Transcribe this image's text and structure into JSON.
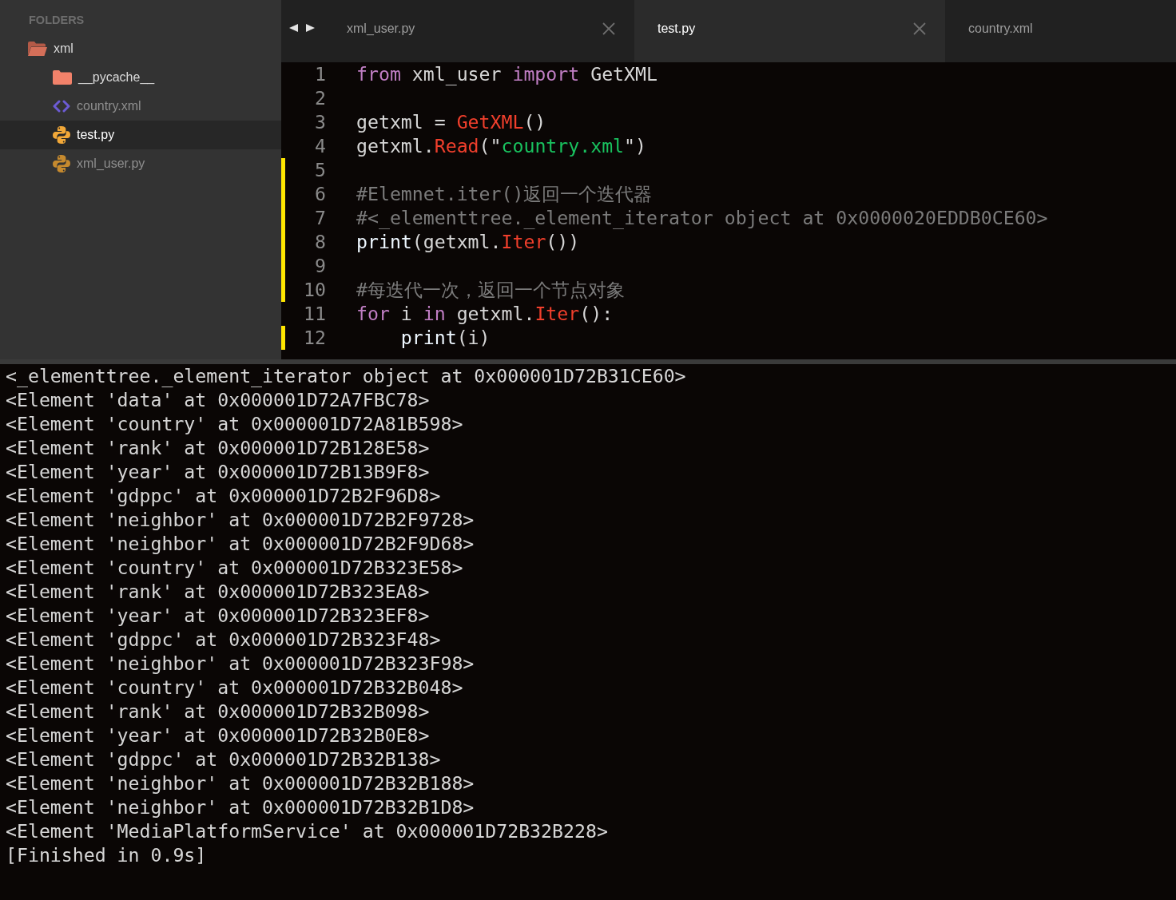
{
  "sidebar": {
    "heading": "FOLDERS",
    "tree": [
      {
        "label": "xml",
        "kind": "folder",
        "expanded": true,
        "selected": false,
        "children": [
          {
            "label": "__pycache__",
            "kind": "folder",
            "expanded": false,
            "selected": false
          },
          {
            "label": "country.xml",
            "kind": "xml",
            "selected": false
          },
          {
            "label": "test.py",
            "kind": "python",
            "selected": true
          },
          {
            "label": "xml_user.py",
            "kind": "python",
            "selected": false
          }
        ]
      }
    ]
  },
  "tabs": [
    {
      "label": "xml_user.py",
      "selected": false,
      "closable": true
    },
    {
      "label": "test.py",
      "selected": true,
      "closable": true
    },
    {
      "label": "country.xml",
      "selected": false,
      "closable": false
    }
  ],
  "editor": {
    "lines": [
      {
        "number": "1",
        "modified": false,
        "tokens": [
          {
            "text": "from",
            "kind": "keyword"
          },
          {
            "text": " xml_user ",
            "kind": "plain"
          },
          {
            "text": "import",
            "kind": "keyword"
          },
          {
            "text": " GetXML",
            "kind": "plain"
          }
        ]
      },
      {
        "number": "2",
        "modified": false
      },
      {
        "number": "3",
        "modified": false,
        "tokens": [
          {
            "text": "getxml = ",
            "kind": "plain"
          },
          {
            "text": "GetXML",
            "kind": "call"
          },
          {
            "text": "()",
            "kind": "plain"
          }
        ]
      },
      {
        "number": "4",
        "modified": false,
        "tokens": [
          {
            "text": "getxml.",
            "kind": "plain"
          },
          {
            "text": "Read",
            "kind": "call"
          },
          {
            "text": "(\"",
            "kind": "plain"
          },
          {
            "text": "country.xml",
            "kind": "string"
          },
          {
            "text": "\")",
            "kind": "plain"
          }
        ]
      },
      {
        "number": "5",
        "modified": true
      },
      {
        "number": "6",
        "modified": true,
        "tokens": [
          {
            "text": "#Elemnet.iter()返回一个迭代器",
            "kind": "comment"
          }
        ]
      },
      {
        "number": "7",
        "modified": true,
        "tokens": [
          {
            "text": "#<_elementtree._element_iterator object at 0x0000020EDDB0CE60>",
            "kind": "comment"
          }
        ]
      },
      {
        "number": "8",
        "modified": true,
        "tokens": [
          {
            "text": "print",
            "kind": "builtin"
          },
          {
            "text": "(getxml.",
            "kind": "plain"
          },
          {
            "text": "Iter",
            "kind": "call"
          },
          {
            "text": "())",
            "kind": "plain"
          }
        ]
      },
      {
        "number": "9",
        "modified": true
      },
      {
        "number": "10",
        "modified": true,
        "tokens": [
          {
            "text": "#每迭代一次，返回一个节点对象",
            "kind": "comment"
          }
        ]
      },
      {
        "number": "11",
        "modified": false,
        "tokens": [
          {
            "text": "for",
            "kind": "keyword"
          },
          {
            "text": " i ",
            "kind": "plain"
          },
          {
            "text": "in",
            "kind": "keyword"
          },
          {
            "text": " getxml.",
            "kind": "plain"
          },
          {
            "text": "Iter",
            "kind": "call"
          },
          {
            "text": "():",
            "kind": "plain"
          }
        ]
      },
      {
        "number": "12",
        "modified": true,
        "tokens": [
          {
            "text": "    print",
            "kind": "builtin"
          },
          {
            "text": "(i)",
            "kind": "plain"
          }
        ]
      }
    ]
  },
  "output": {
    "lines": [
      "<_elementtree._element_iterator object at 0x000001D72B31CE60>",
      "<Element 'data' at 0x000001D72A7FBC78>",
      "<Element 'country' at 0x000001D72A81B598>",
      "<Element 'rank' at 0x000001D72B128E58>",
      "<Element 'year' at 0x000001D72B13B9F8>",
      "<Element 'gdppc' at 0x000001D72B2F96D8>",
      "<Element 'neighbor' at 0x000001D72B2F9728>",
      "<Element 'neighbor' at 0x000001D72B2F9D68>",
      "<Element 'country' at 0x000001D72B323E58>",
      "<Element 'rank' at 0x000001D72B323EA8>",
      "<Element 'year' at 0x000001D72B323EF8>",
      "<Element 'gdppc' at 0x000001D72B323F48>",
      "<Element 'neighbor' at 0x000001D72B323F98>",
      "<Element 'country' at 0x000001D72B32B048>",
      "<Element 'rank' at 0x000001D72B32B098>",
      "<Element 'year' at 0x000001D72B32B0E8>",
      "<Element 'gdppc' at 0x000001D72B32B138>",
      "<Element 'neighbor' at 0x000001D72B32B188>",
      "<Element 'neighbor' at 0x000001D72B32B1D8>",
      "<Element 'MediaPlatformService' at 0x000001D72B32B228>",
      "[Finished in 0.9s]"
    ]
  }
}
